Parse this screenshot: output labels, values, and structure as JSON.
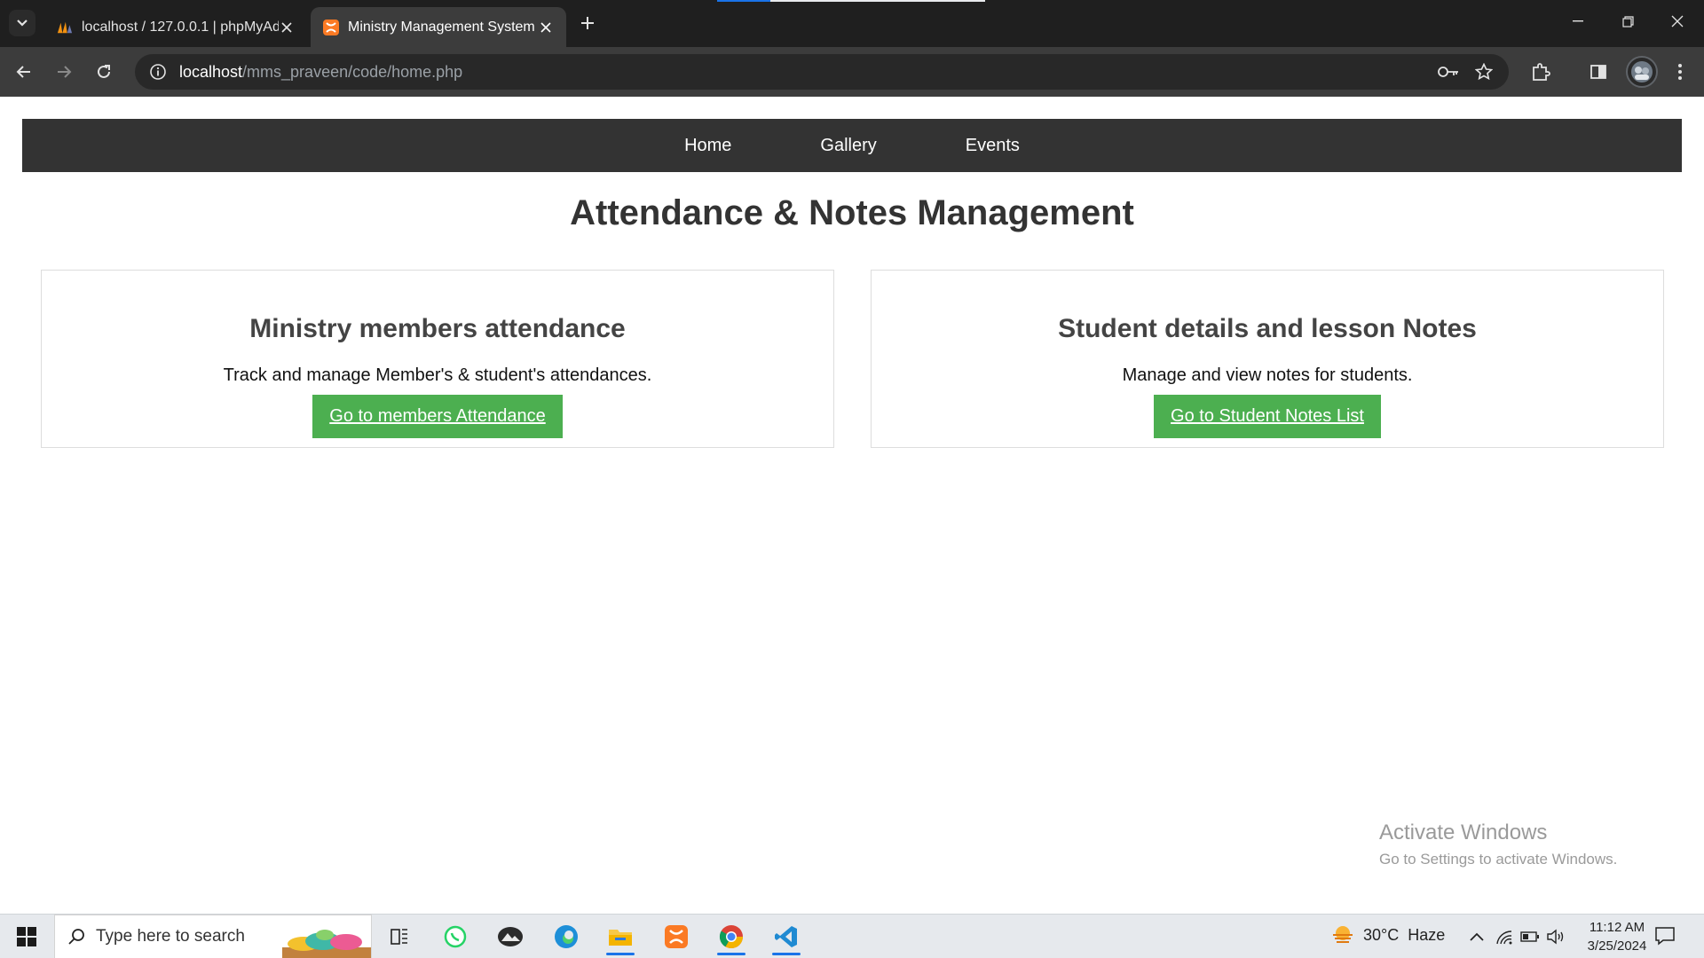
{
  "browser": {
    "tabs": [
      {
        "title": "localhost / 127.0.0.1 | phpMyAdmin",
        "favicon": "phpmyadmin-icon",
        "active": false
      },
      {
        "title": "Ministry Management System",
        "favicon": "xampp-icon",
        "active": true
      }
    ],
    "url_host": "localhost",
    "url_path": "/mms_praveen/code/home.php"
  },
  "site": {
    "nav": [
      "Home",
      "Gallery",
      "Events"
    ],
    "heading": "Attendance & Notes Management",
    "cards": [
      {
        "title": "Ministry members attendance",
        "description": "Track and manage Member's & student's attendances.",
        "button": "Go to members Attendance"
      },
      {
        "title": "Student details and lesson Notes",
        "description": "Manage and view notes for students.",
        "button": "Go to Student Notes List"
      }
    ]
  },
  "watermark": {
    "line1": "Activate Windows",
    "line2": "Go to Settings to activate Windows."
  },
  "taskbar": {
    "search_placeholder": "Type here to search",
    "apps": [
      "task-view-icon",
      "whatsapp-icon",
      "photos-icon",
      "edge-icon",
      "file-explorer-icon",
      "xampp-icon",
      "chrome-icon",
      "vscode-icon"
    ],
    "weather_temp": "30°C",
    "weather_condition": "Haze",
    "time": "11:12 AM",
    "date": "3/25/2024"
  },
  "colors": {
    "nav_bg": "#333333",
    "button_green": "#4caf50",
    "chrome_dark": "#1f1f1f"
  }
}
